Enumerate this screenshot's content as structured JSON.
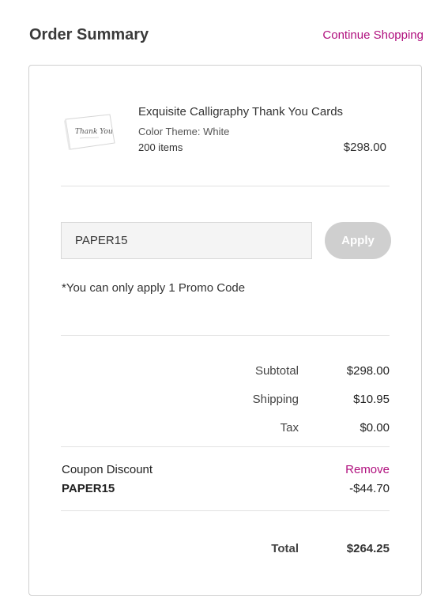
{
  "header": {
    "title": "Order Summary",
    "continue_label": "Continue Shopping"
  },
  "product": {
    "name": "Exquisite Calligraphy Thank You Cards",
    "theme": "Color Theme: White",
    "quantity": "200 items",
    "price": "$298.00",
    "thumbnail_text": "Thank You"
  },
  "promo": {
    "value": "PAPER15",
    "apply_label": "Apply",
    "note": "*You can only apply 1 Promo Code"
  },
  "totals": {
    "subtotal_label": "Subtotal",
    "subtotal_value": "$298.00",
    "shipping_label": "Shipping",
    "shipping_value": "$10.95",
    "tax_label": "Tax",
    "tax_value": "$0.00"
  },
  "coupon": {
    "label": "Coupon Discount",
    "code": "PAPER15",
    "remove_label": "Remove",
    "amount": "-$44.70"
  },
  "total": {
    "label": "Total",
    "value": "$264.25"
  },
  "colors": {
    "accent": "#b0107e",
    "button_disabled": "#cfcfcf"
  }
}
